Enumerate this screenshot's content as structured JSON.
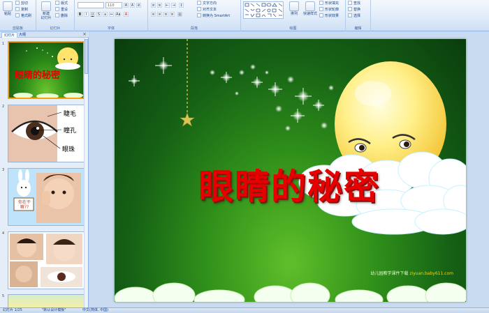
{
  "ribbon": {
    "clipboard": {
      "label": "剪贴板",
      "paste": "粘贴",
      "cut": "剪切",
      "copy": "复制",
      "format": "格式刷"
    },
    "slides": {
      "label": "幻灯片",
      "new_slide_1": "新建",
      "new_slide_2": "幻灯片",
      "layout": "版式",
      "reset": "重设",
      "delete": "删除"
    },
    "font": {
      "label": "字体",
      "font_size": "110"
    },
    "paragraph": {
      "label": "段落",
      "text_direction": "文字方向",
      "align_text": "对齐文本",
      "smartart": "转换为 SmartArt"
    },
    "drawing": {
      "label": "绘图",
      "arrange": "排列",
      "quick_styles": "快速样式",
      "shape_fill": "形状填充",
      "shape_outline": "形状轮廓",
      "shape_effects": "形状效果"
    },
    "editing": {
      "label": "编辑",
      "find": "查找",
      "replace": "替换",
      "select": "选择"
    }
  },
  "left_panel": {
    "tabs": [
      "幻灯片",
      "大纲"
    ],
    "close": "×",
    "thumbnails": [
      {
        "num": "1",
        "title": "眼睛的秘密"
      },
      {
        "num": "2",
        "labels": [
          "睫毛",
          "瞳孔",
          "眼珠"
        ]
      },
      {
        "num": "3",
        "sign": "你在干嘛??"
      },
      {
        "num": "4"
      },
      {
        "num": "5"
      }
    ]
  },
  "slide": {
    "title": "眼睛的秘密",
    "credit_text": "幼儿园教学课件下载",
    "credit_url": "ziyuan.baby611.com"
  },
  "status_bar": {
    "slide_info": "幻灯片 1/25",
    "theme": "\"默认设计模板\"",
    "language": "中文(简体, 中国)"
  },
  "colors": {
    "title_red": "#e60000",
    "slide_green": "#156015",
    "selection_orange": "#f4a300",
    "ribbon_blue": "#dbe7f6"
  }
}
